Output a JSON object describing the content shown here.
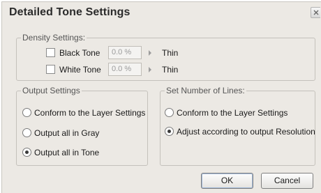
{
  "dialog": {
    "title": "Detailed Tone Settings",
    "close_icon": "close-icon"
  },
  "density": {
    "legend": "Density Settings:",
    "black": {
      "label": "Black Tone",
      "checked": false,
      "value": "0.0 %",
      "result": "Thin"
    },
    "white": {
      "label": "White Tone",
      "checked": false,
      "value": "0.0 %",
      "result": "Thin"
    }
  },
  "output": {
    "legend": "Output Settings",
    "options": [
      {
        "label": "Conform to the Layer Settings",
        "selected": false
      },
      {
        "label": "Output all in Gray",
        "selected": false
      },
      {
        "label": "Output all in Tone",
        "selected": true
      }
    ]
  },
  "lines": {
    "legend": "Set Number of Lines:",
    "options": [
      {
        "label": "Conform to the Layer Settings",
        "selected": false
      },
      {
        "label": "Adjust according to output Resolution",
        "selected": true
      }
    ]
  },
  "buttons": {
    "ok": "OK",
    "cancel": "Cancel"
  },
  "colors": {
    "dialog_bg": "#ece9e4",
    "group_border": "#c4c1bb",
    "disabled_text": "#9a9a9a"
  }
}
